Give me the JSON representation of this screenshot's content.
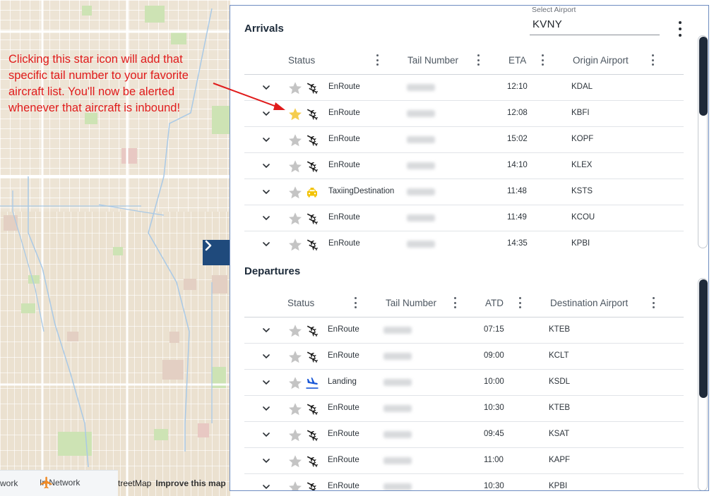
{
  "annotation": {
    "text": "Clicking this star icon will add that specific tail number to your favorite aircraft list. You'll now be alerted whenever that aircraft is inbound!",
    "color": "#e01b1b"
  },
  "map": {
    "legend_network_label": "work",
    "legend_in_network_label": "In Network",
    "attribution_text": "treetMap",
    "improve_link": "Improve this map",
    "plane_icon": "plane-icon",
    "collapse_icon": "chevron-right-icon"
  },
  "colors": {
    "accent_blue": "#1f4a7c",
    "star_favorite": "#f5cd4f",
    "star_default": "#c4c4c4",
    "taxi_yellow": "#f2c200",
    "landing_blue": "#1655d6",
    "in_network_orange": "#f08a24"
  },
  "header": {
    "select_label": "Select Airport",
    "select_value": "KVNY",
    "more_icon": "more-vert-icon"
  },
  "arrivals": {
    "title": "Arrivals",
    "columns": [
      "Status",
      "Tail Number",
      "ETA",
      "Origin Airport"
    ],
    "rows": [
      {
        "status": "EnRoute",
        "status_icon": "enroute-icon",
        "favorite": false,
        "time": "12:10",
        "airport": "KDAL"
      },
      {
        "status": "EnRoute",
        "status_icon": "enroute-icon",
        "favorite": true,
        "time": "12:08",
        "airport": "KBFI"
      },
      {
        "status": "EnRoute",
        "status_icon": "enroute-icon",
        "favorite": false,
        "time": "15:02",
        "airport": "KOPF"
      },
      {
        "status": "EnRoute",
        "status_icon": "enroute-icon",
        "favorite": false,
        "time": "14:10",
        "airport": "KLEX"
      },
      {
        "status": "TaxiingDestination",
        "status_icon": "taxi-icon",
        "favorite": false,
        "time": "11:48",
        "airport": "KSTS"
      },
      {
        "status": "EnRoute",
        "status_icon": "enroute-icon",
        "favorite": false,
        "time": "11:49",
        "airport": "KCOU"
      },
      {
        "status": "EnRoute",
        "status_icon": "enroute-icon",
        "favorite": false,
        "time": "14:35",
        "airport": "KPBI"
      }
    ]
  },
  "departures": {
    "title": "Departures",
    "columns": [
      "Status",
      "Tail Number",
      "ATD",
      "Destination Airport"
    ],
    "rows": [
      {
        "status": "EnRoute",
        "status_icon": "enroute-icon",
        "favorite": false,
        "time": "07:15",
        "airport": "KTEB"
      },
      {
        "status": "EnRoute",
        "status_icon": "enroute-icon",
        "favorite": false,
        "time": "09:00",
        "airport": "KCLT"
      },
      {
        "status": "Landing",
        "status_icon": "landing-icon",
        "favorite": false,
        "time": "10:00",
        "airport": "KSDL"
      },
      {
        "status": "EnRoute",
        "status_icon": "enroute-icon",
        "favorite": false,
        "time": "10:30",
        "airport": "KTEB"
      },
      {
        "status": "EnRoute",
        "status_icon": "enroute-icon",
        "favorite": false,
        "time": "09:45",
        "airport": "KSAT"
      },
      {
        "status": "EnRoute",
        "status_icon": "enroute-icon",
        "favorite": false,
        "time": "11:00",
        "airport": "KAPF"
      },
      {
        "status": "EnRoute",
        "status_icon": "enroute-icon",
        "favorite": false,
        "time": "10:30",
        "airport": "KPBI"
      }
    ]
  }
}
